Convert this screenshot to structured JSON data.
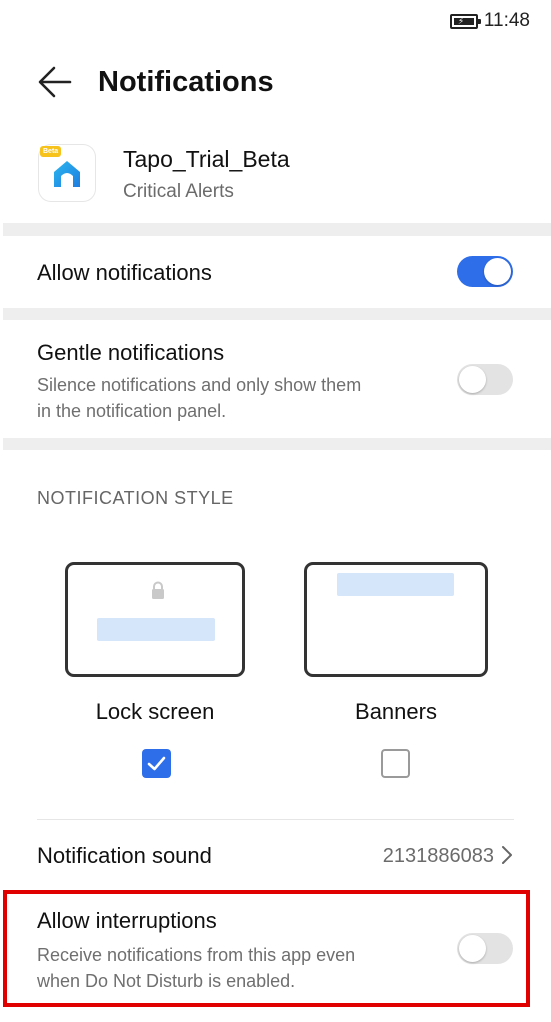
{
  "status_bar": {
    "time": "11:48",
    "battery_icon": "battery-charging-icon"
  },
  "header": {
    "back_icon": "arrow-left-icon",
    "title": "Notifications"
  },
  "app": {
    "name": "Tapo_Trial_Beta",
    "subtitle": "Critical Alerts",
    "icon": "tapo-app-icon",
    "beta_tag": "Beta"
  },
  "allow_notifications": {
    "label": "Allow notifications",
    "enabled": true
  },
  "gentle_notifications": {
    "label": "Gentle notifications",
    "description_line1": "Silence notifications and only show them",
    "description_line2": "in the notification panel.",
    "enabled": false
  },
  "notification_style": {
    "section_label": "NOTIFICATION STYLE",
    "options": [
      {
        "label": "Lock screen",
        "checked": true,
        "icon": "lock-icon"
      },
      {
        "label": "Banners",
        "checked": false
      }
    ]
  },
  "notification_sound": {
    "label": "Notification sound",
    "value": "2131886083",
    "chevron_icon": "chevron-right-icon"
  },
  "allow_interruptions": {
    "label": "Allow interruptions",
    "description_line1": "Receive notifications from this app even",
    "description_line2": "when Do Not Disturb is enabled.",
    "enabled": false
  },
  "colors": {
    "accent": "#2f6ee9",
    "highlight": "#e00000",
    "preview_bar": "#d5e5fa",
    "divider": "#eeeeee"
  }
}
